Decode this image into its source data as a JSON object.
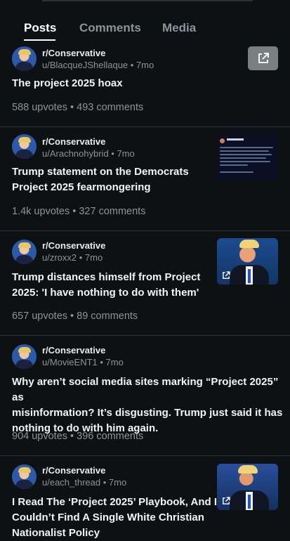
{
  "tabs": [
    {
      "label": "Posts",
      "active": true
    },
    {
      "label": "Comments",
      "active": false
    },
    {
      "label": "Media",
      "active": false
    }
  ],
  "posts": [
    {
      "subreddit": "r/Conservative",
      "meta": "u/BlacqueJShellaque • 7mo",
      "title_lines": [
        "The project 2025 hoax"
      ],
      "stats": "588 upvotes • 493 comments",
      "thumbnail": "external-link-icon"
    },
    {
      "subreddit": "r/Conservative",
      "meta": "u/Arachnohybrid • 7mo",
      "title_lines": [
        "Trump statement on the Democrats",
        "Project 2025 fearmongering"
      ],
      "stats": "1.4k upvotes • 327 comments",
      "thumbnail": "tweet-screenshot"
    },
    {
      "subreddit": "r/Conservative",
      "meta": "u/zroxx2 • 7mo",
      "title_lines": [
        "Trump distances himself from Project",
        "2025: 'I have nothing to do with them'"
      ],
      "stats": "657 upvotes • 89 comments",
      "thumbnail": "photo-with-link"
    },
    {
      "subreddit": "r/Conservative",
      "meta": "u/MovieENT1 • 7mo",
      "title_lines": [
        "Why aren’t social media sites marking “Project 2025” as",
        "misinformation? It’s disgusting. Trump just said it has",
        "nothing to do with him again."
      ],
      "stats": "904 upvotes • 396 comments",
      "thumbnail": "none"
    },
    {
      "subreddit": "r/Conservative",
      "meta": "u/each_thread • 7mo",
      "title_lines": [
        "I Read The ‘Project 2025’ Playbook, And I",
        "Couldn’t Find A Single White Christian",
        "Nationalist Policy"
      ],
      "stats": "",
      "thumbnail": "photo-with-link"
    }
  ]
}
